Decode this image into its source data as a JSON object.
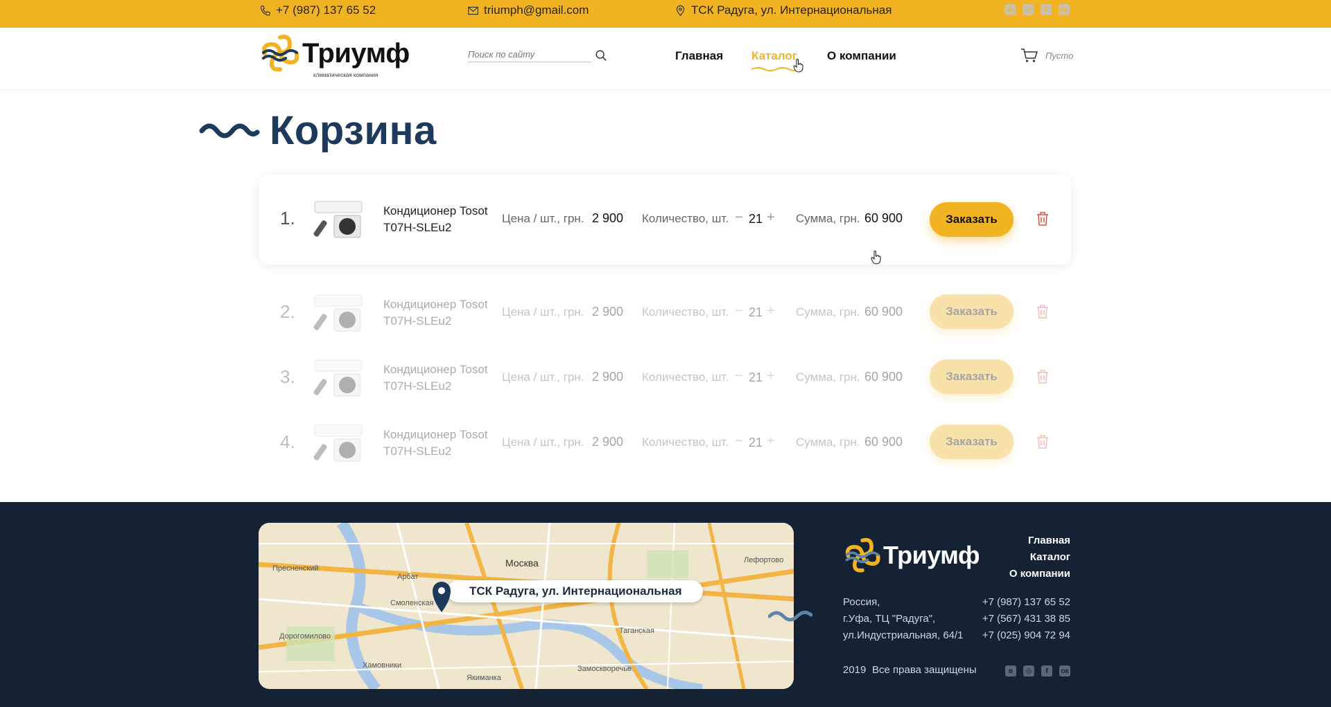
{
  "topbar": {
    "phone": "+7 (987) 137 65 52",
    "email": "triumph@gmail.com",
    "address": "ТСК Радуга, ул. Интернациональная",
    "social": [
      "vk-icon",
      "odnoklassniki-circle-icon",
      "facebook-icon",
      "odnoklassniki-icon"
    ]
  },
  "header": {
    "logo_text": "Триумф",
    "logo_sub": "климатическая компания",
    "search_placeholder": "Поиск по сайту",
    "nav": [
      {
        "label": "Главная",
        "active": false
      },
      {
        "label": "Каталог",
        "active": true
      },
      {
        "label": "О компании",
        "active": false
      }
    ],
    "cart_label": "Пусто"
  },
  "page_title": "Корзина",
  "cart_items": [
    {
      "num": "1.",
      "name": "Кондиционер Tosot T07H-SLEu2",
      "price_label": "Цена / шт., грн.",
      "price": "2 900",
      "qty_label": "Количество, шт.",
      "qty": "21",
      "sum_label": "Сумма, грн.",
      "sum": "60 900",
      "order_label": "Заказать"
    },
    {
      "num": "2.",
      "name": "Кондиционер Tosot T07H-SLEu2",
      "price_label": "Цена / шт., грн.",
      "price": "2 900",
      "qty_label": "Количество, шт.",
      "qty": "21",
      "sum_label": "Сумма, грн.",
      "sum": "60 900",
      "order_label": "Заказать"
    },
    {
      "num": "3.",
      "name": "Кондиционер Tosot T07H-SLEu2",
      "price_label": "Цена / шт., грн.",
      "price": "2 900",
      "qty_label": "Количество, шт.",
      "qty": "21",
      "sum_label": "Сумма, грн.",
      "sum": "60 900",
      "order_label": "Заказать"
    },
    {
      "num": "4.",
      "name": "Кондиционер Tosot T07H-SLEu2",
      "price_label": "Цена / шт., грн.",
      "price": "2 900",
      "qty_label": "Количество, шт.",
      "qty": "21",
      "sum_label": "Сумма, грн.",
      "sum": "60 900",
      "order_label": "Заказать"
    }
  ],
  "map": {
    "pin_label": "ТСК Радуга, ул. Интернациональная",
    "place_names": [
      "Москва",
      "Арбат",
      "Лефортово",
      "Таганская",
      "Замоскворечье",
      "Якиманка",
      "Дорогомилово",
      "Пресненский",
      "Хамовники",
      "Смоленская"
    ]
  },
  "footer": {
    "logo_text": "Триумф",
    "links": [
      "Главная",
      "Каталог",
      "О компании"
    ],
    "address_lines": [
      "Россия,",
      "г.Уфа, ТЦ \"Радуга\",",
      "ул.Индустриальная, 64/1"
    ],
    "phones": [
      "+7 (987) 137 65 52",
      "+7 (567) 431 38 85",
      "+7 (025) 904 72 94"
    ],
    "year": "2019",
    "rights": "Все права защищены",
    "social": [
      "vk-icon",
      "odnoklassniki-circle-icon",
      "facebook-icon",
      "odnoklassniki-icon"
    ]
  },
  "colors": {
    "accent": "#f1b321",
    "title": "#1d3a5c",
    "footer_bg": "#152233"
  }
}
